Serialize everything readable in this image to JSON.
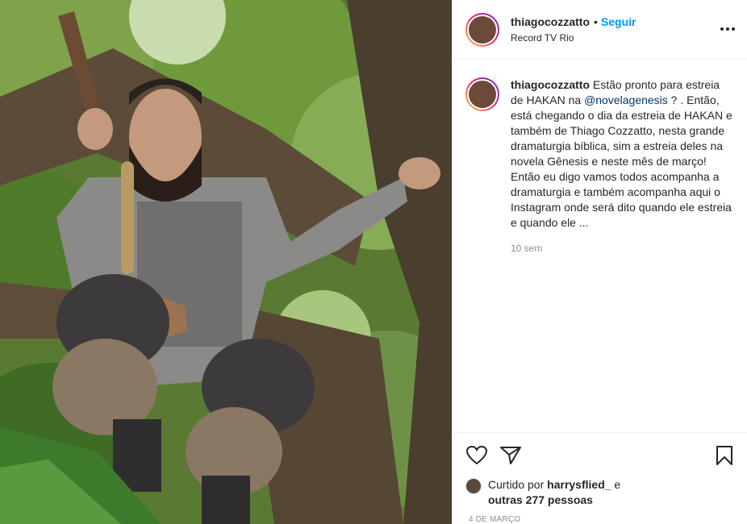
{
  "post": {
    "username": "thiagocozzatto",
    "separator": "•",
    "follow_label": "Seguir",
    "location": "Record TV Rio",
    "more_label": "..."
  },
  "caption": {
    "username": "thiagocozzatto",
    "text_before_mention": " Estão pronto para estreia de HAKAN na ",
    "mention": "@novelagenesis",
    "text_after_mention": " ? . Então, está chegando o dia da estreia de HAKAN e também de Thiago Cozzatto, nesta grande dramaturgia bíblica, sim a estreia deles na novela Gênesis e neste mês de março! Então eu digo vamos todos acompanha a dramaturgia e também acompanha aqui o Instagram onde será dito quando ele estreia e quando ele ...",
    "time_ago": "10 sem"
  },
  "likes": {
    "prefix": "Curtido por ",
    "user": "harrysflied_",
    "middle": " e ",
    "others": "outras 277 pessoas"
  },
  "date": "4 DE MARÇO",
  "icons": {
    "like": "heart-icon",
    "share": "send-icon",
    "save": "bookmark-icon",
    "more": "more-options-icon"
  },
  "colors": {
    "link": "#0095f6",
    "mention": "#00376b",
    "muted": "#8e8e8e",
    "border": "#efefef"
  }
}
